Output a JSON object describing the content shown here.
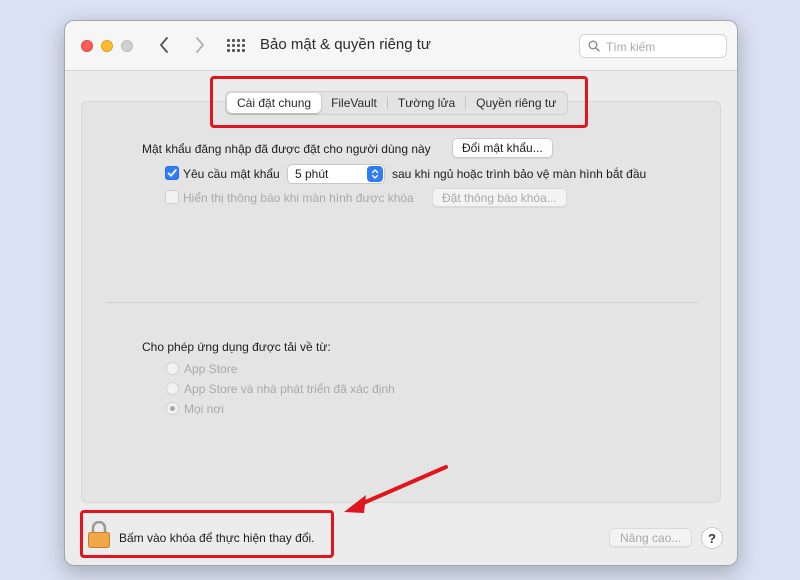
{
  "window": {
    "title": "Bảo mật & quyền riêng tư"
  },
  "search": {
    "placeholder": "Tìm kiếm"
  },
  "tabs": [
    {
      "label": "Cài đặt chung",
      "active": true
    },
    {
      "label": "FileVault",
      "active": false
    },
    {
      "label": "Tường lửa",
      "active": false
    },
    {
      "label": "Quyền riêng tư",
      "active": false
    }
  ],
  "general": {
    "password_text": "Mật khẩu đăng nhập đã được đặt cho người dùng này",
    "change_password_button": "Đổi mật khẩu...",
    "require_password": {
      "label": "Yêu cầu mật khẩu",
      "checked": true,
      "delay_value": "5 phút",
      "suffix": "sau khi ngủ hoặc trình bảo vệ màn hình bắt đầu"
    },
    "show_message": {
      "label": "Hiển thị thông báo khi màn hình được khóa",
      "checked": false,
      "button": "Đặt thông báo khóa..."
    },
    "allow_apps": {
      "heading": "Cho phép ứng dụng được tải về từ:",
      "options": [
        "App Store",
        "App Store và nhà phát triển đã xác định",
        "Mọi nơi"
      ],
      "selected": "Mọi nơi"
    }
  },
  "footer": {
    "lock_text": "Bấm vào khóa để thực hiện thay đổi.",
    "advanced_button": "Nâng cao...",
    "help_button": "?"
  },
  "colors": {
    "accent": "#2f7cf6",
    "highlight": "#e0151d"
  },
  "icons": [
    "back-chevron-icon",
    "forward-chevron-icon",
    "grid-icon",
    "search-icon",
    "lock-icon",
    "popup-arrows-icon"
  ]
}
